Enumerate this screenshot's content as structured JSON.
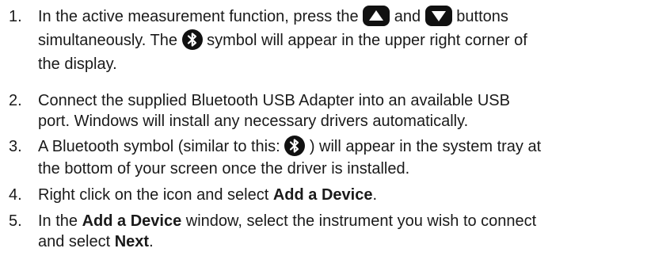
{
  "steps": [
    {
      "number": "1.",
      "part1": "In the active measurement function, press the",
      "icon1": "up-arrow-button-icon",
      "part2": "and",
      "icon2": "down-arrow-button-icon",
      "part3": "buttons",
      "line2_part1": "simultaneously. The",
      "icon3": "bluetooth-icon",
      "line2_part2": "symbol will appear in the upper right corner of",
      "line3": "the display."
    },
    {
      "number": "2.",
      "line1": "Connect the supplied Bluetooth USB Adapter into an available USB",
      "line2": "port. Windows will install any necessary drivers automatically."
    },
    {
      "number": "3.",
      "part1": "A Bluetooth symbol (similar to this:",
      "icon": "bluetooth-icon",
      "part2": ") will appear in the system tray at",
      "line2": "the bottom of your screen once the driver is installed."
    },
    {
      "number": "4.",
      "part1": "Right click on the icon and select",
      "bold1": "Add a Device",
      "part2": "."
    },
    {
      "number": "5.",
      "part1": "In the",
      "bold1": "Add a Device",
      "part2": "window, select the instrument you wish to connect",
      "line2_part1": "and select",
      "bold2": "Next",
      "line2_part2": "."
    }
  ]
}
